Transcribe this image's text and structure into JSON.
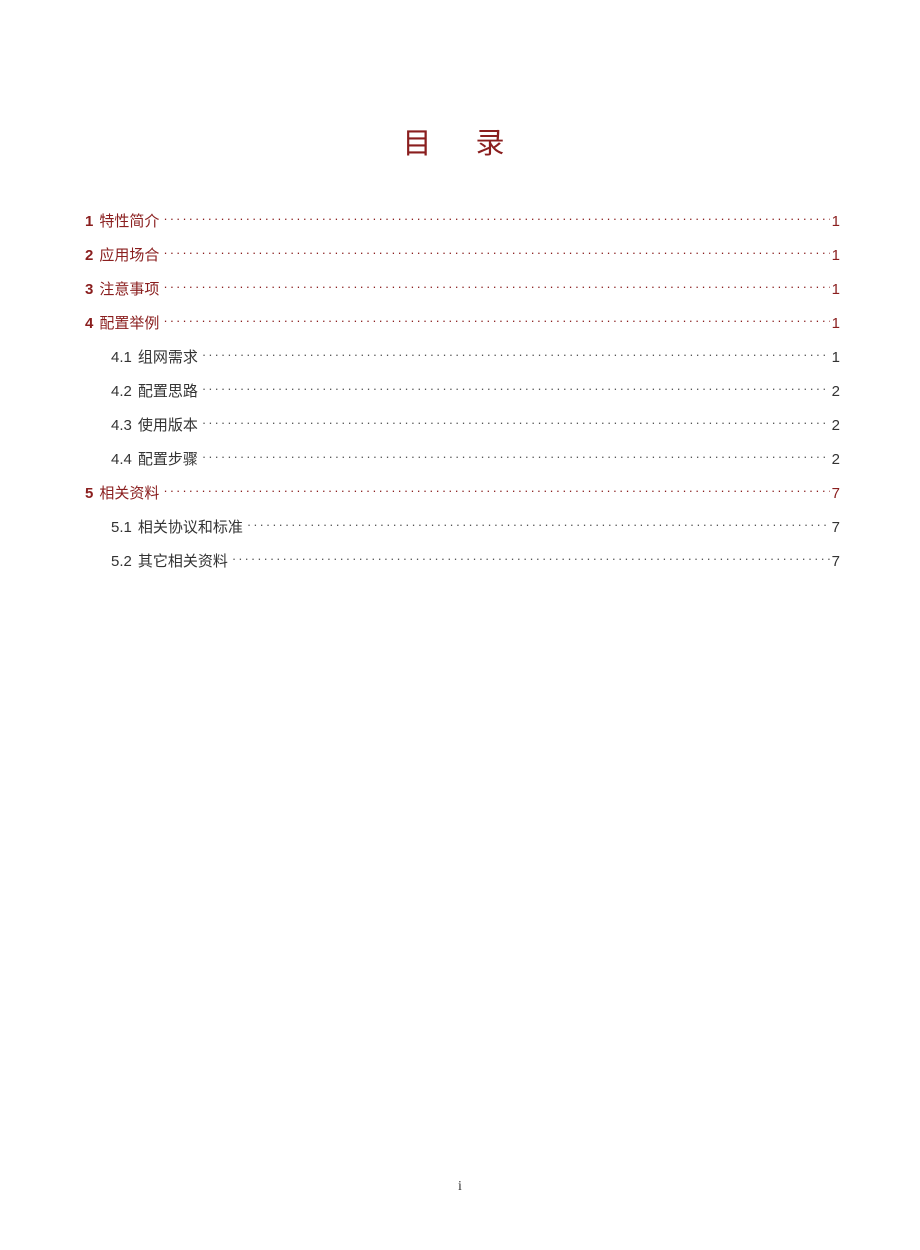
{
  "title": "目 录",
  "pageNumber": "i",
  "toc": [
    {
      "level": 1,
      "num": "1",
      "label": "特性简介",
      "page": "1"
    },
    {
      "level": 1,
      "num": "2",
      "label": "应用场合",
      "page": "1"
    },
    {
      "level": 1,
      "num": "3",
      "label": "注意事项",
      "page": "1"
    },
    {
      "level": 1,
      "num": "4",
      "label": "配置举例",
      "page": "1"
    },
    {
      "level": 2,
      "num": "4.1",
      "label": "组网需求",
      "page": "1"
    },
    {
      "level": 2,
      "num": "4.2",
      "label": "配置思路",
      "page": "2"
    },
    {
      "level": 2,
      "num": "4.3",
      "label": "使用版本",
      "page": "2"
    },
    {
      "level": 2,
      "num": "4.4",
      "label": "配置步骤",
      "page": "2"
    },
    {
      "level": 1,
      "num": "5",
      "label": "相关资料",
      "page": "7"
    },
    {
      "level": 2,
      "num": "5.1",
      "label": "相关协议和标准",
      "page": "7"
    },
    {
      "level": 2,
      "num": "5.2",
      "label": "其它相关资料",
      "page": "7"
    }
  ]
}
